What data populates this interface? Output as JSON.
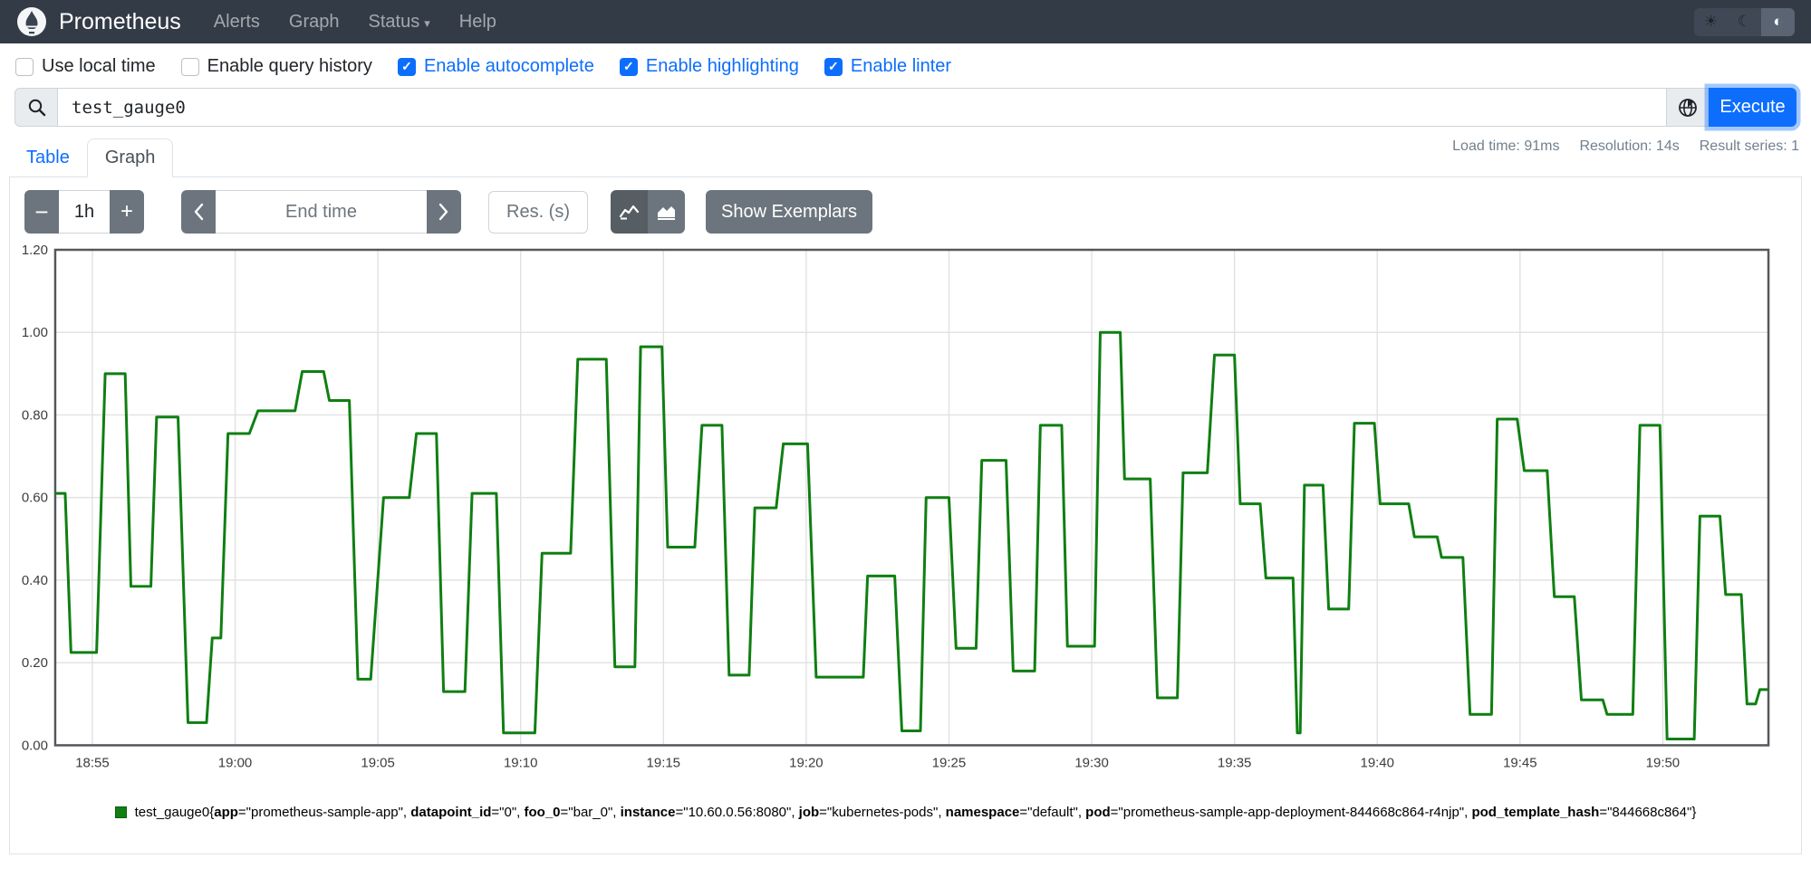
{
  "navbar": {
    "brand": "Prometheus",
    "items": [
      {
        "label": "Alerts"
      },
      {
        "label": "Graph"
      },
      {
        "label": "Status",
        "caret": "▾"
      },
      {
        "label": "Help"
      }
    ]
  },
  "options": [
    {
      "label": "Use local time",
      "checked": false
    },
    {
      "label": "Enable query history",
      "checked": false
    },
    {
      "label": "Enable autocomplete",
      "checked": true
    },
    {
      "label": "Enable highlighting",
      "checked": true
    },
    {
      "label": "Enable linter",
      "checked": true
    }
  ],
  "query": {
    "value": "test_gauge0",
    "execute_label": "Execute",
    "check_glyph": "✓"
  },
  "tabs": {
    "table": "Table",
    "graph": "Graph"
  },
  "stats": {
    "load_time": "Load time: 91ms",
    "resolution": "Resolution: 14s",
    "result_series": "Result series: 1"
  },
  "toolbar": {
    "minus": "−",
    "duration": "1h",
    "plus": "+",
    "end_time_placeholder": "End time",
    "res_placeholder": "Res. (s)",
    "show_exemplars": "Show Exemplars"
  },
  "colors": {
    "accent_blue": "#0d6efd",
    "navbar_bg": "#333b47",
    "series_green": "#0f7f12",
    "grid": "#e1e1e1",
    "chart_border": "#54585c",
    "axis_text": "#3c3c3c"
  },
  "chart_data": {
    "type": "line",
    "series_name": "test_gauge0",
    "x_unit": "minutes past 18:00",
    "t_range": [
      53.7,
      113.7
    ],
    "ylim": [
      0,
      1.2
    ],
    "grid": true,
    "legend_position": "bottom-center",
    "y_ticks": [
      {
        "v": 0.0,
        "label": "0.00"
      },
      {
        "v": 0.2,
        "label": "0.20"
      },
      {
        "v": 0.4,
        "label": "0.40"
      },
      {
        "v": 0.6,
        "label": "0.60"
      },
      {
        "v": 0.8,
        "label": "0.80"
      },
      {
        "v": 1.0,
        "label": "1.00"
      },
      {
        "v": 1.2,
        "label": "1.20"
      }
    ],
    "x_ticks": [
      {
        "t": 55,
        "label": "18:55"
      },
      {
        "t": 60,
        "label": "19:00"
      },
      {
        "t": 65,
        "label": "19:05"
      },
      {
        "t": 70,
        "label": "19:10"
      },
      {
        "t": 75,
        "label": "19:15"
      },
      {
        "t": 80,
        "label": "19:20"
      },
      {
        "t": 85,
        "label": "19:25"
      },
      {
        "t": 90,
        "label": "19:30"
      },
      {
        "t": 95,
        "label": "19:35"
      },
      {
        "t": 100,
        "label": "19:40"
      },
      {
        "t": 105,
        "label": "19:45"
      },
      {
        "t": 110,
        "label": "19:50"
      }
    ],
    "points": [
      [
        53.7,
        0.61
      ],
      [
        54.05,
        0.61
      ],
      [
        54.25,
        0.225
      ],
      [
        55.15,
        0.225
      ],
      [
        55.45,
        0.9
      ],
      [
        56.15,
        0.9
      ],
      [
        56.35,
        0.385
      ],
      [
        57.05,
        0.385
      ],
      [
        57.25,
        0.795
      ],
      [
        58.0,
        0.795
      ],
      [
        58.35,
        0.055
      ],
      [
        59.0,
        0.055
      ],
      [
        59.2,
        0.26
      ],
      [
        59.5,
        0.26
      ],
      [
        59.75,
        0.755
      ],
      [
        60.5,
        0.755
      ],
      [
        60.8,
        0.81
      ],
      [
        62.1,
        0.81
      ],
      [
        62.35,
        0.905
      ],
      [
        63.1,
        0.905
      ],
      [
        63.3,
        0.835
      ],
      [
        64.0,
        0.835
      ],
      [
        64.3,
        0.16
      ],
      [
        64.75,
        0.16
      ],
      [
        65.2,
        0.6
      ],
      [
        66.1,
        0.6
      ],
      [
        66.35,
        0.755
      ],
      [
        67.05,
        0.755
      ],
      [
        67.3,
        0.13
      ],
      [
        68.05,
        0.13
      ],
      [
        68.3,
        0.61
      ],
      [
        69.15,
        0.61
      ],
      [
        69.4,
        0.03
      ],
      [
        70.5,
        0.03
      ],
      [
        70.75,
        0.465
      ],
      [
        71.75,
        0.465
      ],
      [
        72.0,
        0.935
      ],
      [
        73.0,
        0.935
      ],
      [
        73.3,
        0.19
      ],
      [
        74.0,
        0.19
      ],
      [
        74.2,
        0.965
      ],
      [
        74.95,
        0.965
      ],
      [
        75.15,
        0.48
      ],
      [
        76.1,
        0.48
      ],
      [
        76.35,
        0.775
      ],
      [
        77.05,
        0.775
      ],
      [
        77.3,
        0.17
      ],
      [
        78.0,
        0.17
      ],
      [
        78.2,
        0.575
      ],
      [
        78.95,
        0.575
      ],
      [
        79.2,
        0.73
      ],
      [
        80.05,
        0.73
      ],
      [
        80.35,
        0.165
      ],
      [
        82.0,
        0.165
      ],
      [
        82.15,
        0.41
      ],
      [
        83.1,
        0.41
      ],
      [
        83.35,
        0.035
      ],
      [
        84.0,
        0.035
      ],
      [
        84.2,
        0.6
      ],
      [
        85.0,
        0.6
      ],
      [
        85.25,
        0.235
      ],
      [
        85.95,
        0.235
      ],
      [
        86.15,
        0.69
      ],
      [
        87.0,
        0.69
      ],
      [
        87.25,
        0.18
      ],
      [
        88.0,
        0.18
      ],
      [
        88.2,
        0.775
      ],
      [
        88.95,
        0.775
      ],
      [
        89.15,
        0.24
      ],
      [
        90.1,
        0.24
      ],
      [
        90.3,
        1.0
      ],
      [
        91.0,
        1.0
      ],
      [
        91.15,
        0.645
      ],
      [
        92.05,
        0.645
      ],
      [
        92.3,
        0.115
      ],
      [
        93.0,
        0.115
      ],
      [
        93.2,
        0.66
      ],
      [
        94.05,
        0.66
      ],
      [
        94.3,
        0.945
      ],
      [
        95.0,
        0.945
      ],
      [
        95.2,
        0.585
      ],
      [
        95.9,
        0.585
      ],
      [
        96.1,
        0.405
      ],
      [
        97.05,
        0.405
      ],
      [
        97.2,
        0.03
      ],
      [
        97.3,
        0.03
      ],
      [
        97.45,
        0.63
      ],
      [
        98.1,
        0.63
      ],
      [
        98.3,
        0.33
      ],
      [
        99.0,
        0.33
      ],
      [
        99.2,
        0.78
      ],
      [
        99.9,
        0.78
      ],
      [
        100.1,
        0.585
      ],
      [
        101.1,
        0.585
      ],
      [
        101.3,
        0.505
      ],
      [
        102.1,
        0.505
      ],
      [
        102.25,
        0.455
      ],
      [
        103.0,
        0.455
      ],
      [
        103.25,
        0.075
      ],
      [
        104.0,
        0.075
      ],
      [
        104.2,
        0.79
      ],
      [
        104.9,
        0.79
      ],
      [
        105.15,
        0.665
      ],
      [
        105.95,
        0.665
      ],
      [
        106.2,
        0.36
      ],
      [
        106.9,
        0.36
      ],
      [
        107.15,
        0.11
      ],
      [
        107.9,
        0.11
      ],
      [
        108.05,
        0.075
      ],
      [
        108.95,
        0.075
      ],
      [
        109.2,
        0.775
      ],
      [
        109.9,
        0.775
      ],
      [
        110.15,
        0.015
      ],
      [
        111.1,
        0.015
      ],
      [
        111.3,
        0.555
      ],
      [
        112.0,
        0.555
      ],
      [
        112.2,
        0.365
      ],
      [
        112.75,
        0.365
      ],
      [
        112.95,
        0.1
      ],
      [
        113.25,
        0.1
      ],
      [
        113.4,
        0.135
      ],
      [
        113.7,
        0.135
      ]
    ]
  },
  "legend": {
    "metric": "test_gauge0",
    "open_brace": "{",
    "close_brace": "}",
    "labels": [
      {
        "name": "app",
        "value": "prometheus-sample-app"
      },
      {
        "name": "datapoint_id",
        "value": "0"
      },
      {
        "name": "foo_0",
        "value": "bar_0"
      },
      {
        "name": "instance",
        "value": "10.60.0.56:8080"
      },
      {
        "name": "job",
        "value": "kubernetes-pods"
      },
      {
        "name": "namespace",
        "value": "default"
      },
      {
        "name": "pod",
        "value": "prometheus-sample-app-deployment-844668c864-r4njp"
      },
      {
        "name": "pod_template_hash",
        "value": "844668c864"
      }
    ]
  }
}
